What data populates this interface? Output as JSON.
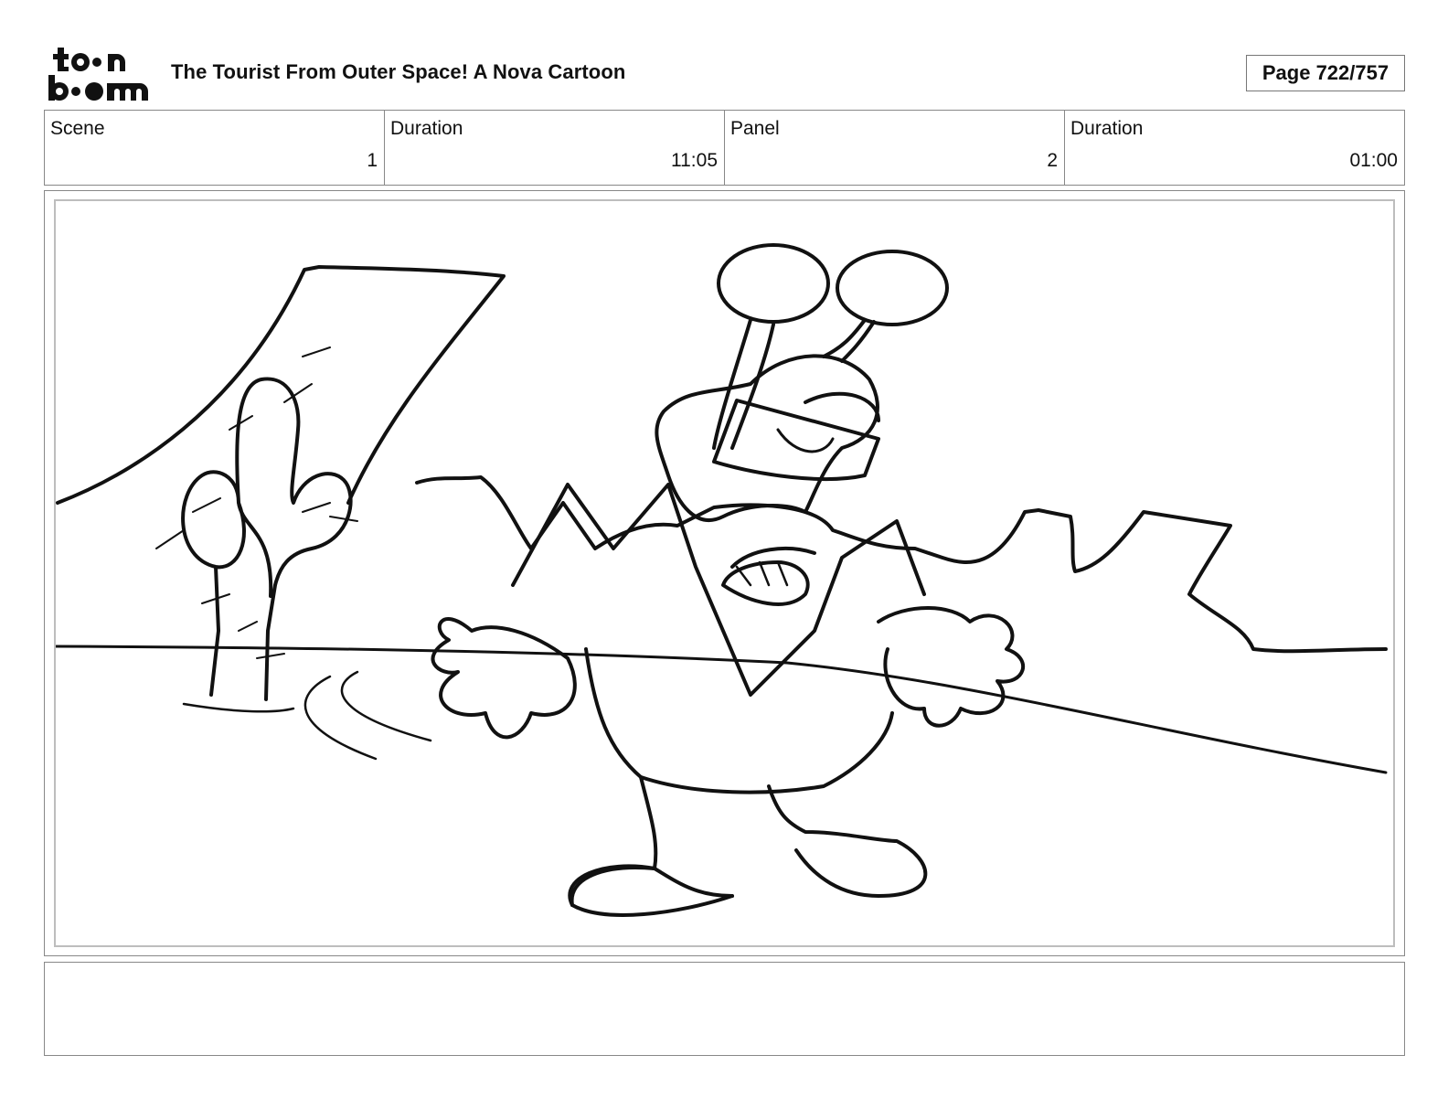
{
  "header": {
    "logo_alt": "toon boom",
    "title": "The Tourist From Outer Space!  A Nova Cartoon",
    "page_label": "Page 722/757"
  },
  "info": {
    "scene": {
      "label": "Scene",
      "value": "1"
    },
    "scene_duration": {
      "label": "Duration",
      "value": "11:05"
    },
    "panel": {
      "label": "Panel",
      "value": "2"
    },
    "panel_duration": {
      "label": "Duration",
      "value": "01:00"
    }
  },
  "panel_image": {
    "description_icon": "storyboard-sketch-alien-in-desert"
  },
  "notes": {
    "text": ""
  }
}
